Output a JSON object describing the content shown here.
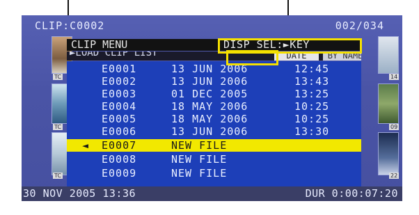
{
  "header": {
    "clip_id": "CLIP:C0002",
    "clip_count": "002/034"
  },
  "menu": {
    "title": "CLIP MENU",
    "disp_sel": "DISP SEL:►KEY",
    "load_item": "►LOAD CLIP LIST",
    "sort_date": "DATE",
    "sort_name": "BY NAME"
  },
  "files": [
    {
      "name": "E0001",
      "date": "13 JUN 2006",
      "time": "12:45",
      "selected": false
    },
    {
      "name": "E0002",
      "date": "13 JUN 2006",
      "time": "13:43",
      "selected": false
    },
    {
      "name": "E0003",
      "date": "01 DEC 2005",
      "time": "13:25",
      "selected": false
    },
    {
      "name": "E0004",
      "date": "18 MAY 2006",
      "time": "10:25",
      "selected": false
    },
    {
      "name": "E0005",
      "date": "18 MAY 2006",
      "time": "10:25",
      "selected": false
    },
    {
      "name": "E0006",
      "date": "13 JUN 2006",
      "time": "13:30",
      "selected": false
    },
    {
      "name": "E0007",
      "date": "NEW FILE",
      "time": "",
      "selected": true,
      "marker": "◄"
    },
    {
      "name": "E0008",
      "date": "NEW FILE",
      "time": "",
      "selected": false
    },
    {
      "name": "E0009",
      "date": "NEW FILE",
      "time": "",
      "selected": false
    }
  ],
  "thumbnails": {
    "tc_label": "TC",
    "num_14": "14",
    "num_09": "09",
    "num_22": "22"
  },
  "footer": {
    "datetime": "30 NOV 2005 13:36",
    "duration": "DUR 0:00:07:20"
  },
  "colors": {
    "selection": "#f2e800",
    "list_bg": "#1d3fb8",
    "callout_box": "#f5e000"
  }
}
